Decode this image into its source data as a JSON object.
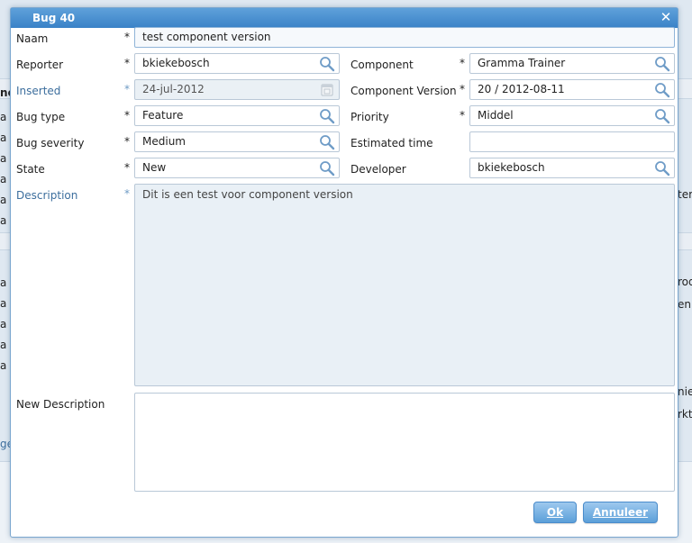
{
  "dialog": {
    "title": "Bug 40",
    "close_icon": "close-icon",
    "ok_label": "Ok",
    "cancel_label": "Annuleer"
  },
  "required_mark": "*",
  "fields": {
    "naam": {
      "label": "Naam",
      "value": "test component version"
    },
    "reporter": {
      "label": "Reporter",
      "value": "bkiekebosch"
    },
    "inserted": {
      "label": "Inserted",
      "value": "24-jul-2012"
    },
    "bug_type": {
      "label": "Bug type",
      "value": "Feature"
    },
    "bug_severity": {
      "label": "Bug severity",
      "value": "Medium"
    },
    "state": {
      "label": "State",
      "value": "New"
    },
    "component": {
      "label": "Component",
      "value": "Gramma Trainer"
    },
    "component_version": {
      "label": "Component Version",
      "value": "20 / 2012-08-11"
    },
    "priority": {
      "label": "Priority",
      "value": "Middel"
    },
    "estimated_time": {
      "label": "Estimated time",
      "value": ""
    },
    "developer": {
      "label": "Developer",
      "value": "bkiekebosch"
    },
    "description": {
      "label": "Description",
      "value": "Dit is een test voor component version"
    },
    "new_description": {
      "label": "New Description",
      "value": ""
    }
  },
  "background": {
    "left_fragments": [
      "ne",
      "a '",
      "a '",
      "a '",
      "a '",
      "a '",
      "a '",
      "a '",
      "a '",
      "a '",
      "a '",
      "a '",
      "ge"
    ],
    "right_fragments": [
      "ter",
      "rod",
      "en",
      "niet",
      "rkt"
    ]
  },
  "colors": {
    "title_bar": "#4a90d2",
    "button": "#7ab4e4",
    "readonly_label": "#3c6e9d"
  }
}
